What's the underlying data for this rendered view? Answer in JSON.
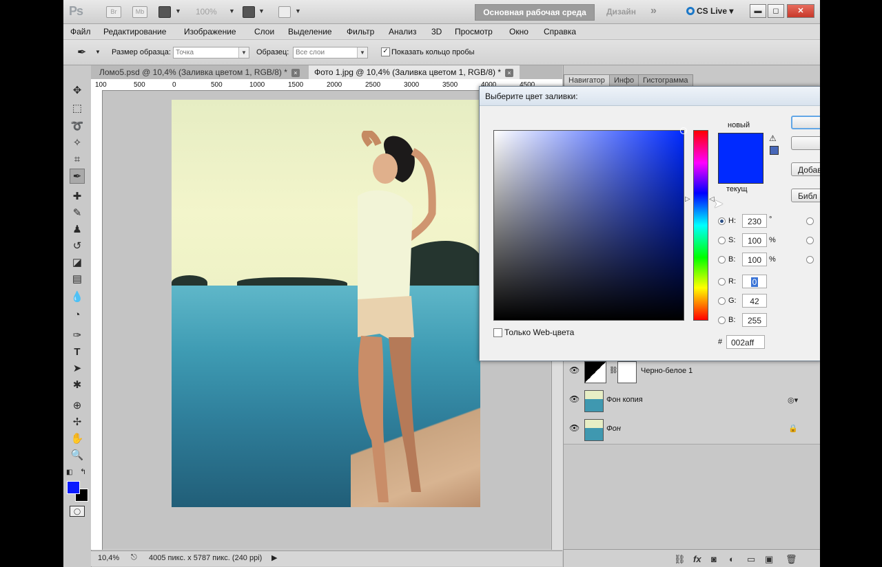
{
  "appbar": {
    "logo": "Ps",
    "bridge": "Br",
    "minibridge": "Mb",
    "zoom": "100%",
    "workspace_active": "Основная рабочая среда",
    "workspace_design": "Дизайн",
    "workspace_more": "»",
    "cslive": "CS Live"
  },
  "menu": [
    "Файл",
    "Редактирование",
    "Изображение",
    "Слои",
    "Выделение",
    "Фильтр",
    "Анализ",
    "3D",
    "Просмотр",
    "Окно",
    "Справка"
  ],
  "options": {
    "sample_size_label": "Размер образца:",
    "sample_size_value": "Точка",
    "sample_label": "Образец:",
    "sample_value": "Все слои",
    "show_ring_label": "Показать кольцо пробы",
    "show_ring_checked": true
  },
  "doc_tabs": [
    {
      "title": "Ломо5.psd @ 10,4% (Заливка цветом 1, RGB/8) *",
      "active": false
    },
    {
      "title": "Фото 1.jpg @ 10,4% (Заливка цветом 1, RGB/8) *",
      "active": true
    }
  ],
  "ruler_ticks": [
    "100",
    "500",
    "0",
    "500",
    "1000",
    "1500",
    "2000",
    "2500",
    "3000",
    "3500",
    "4000",
    "4500"
  ],
  "statusbar": {
    "zoom": "10,4%",
    "doc_info": "4005 пикс. x 5787 пикс. (240 ppi)"
  },
  "panel_tabs": [
    "Навигатор",
    "Инфо",
    "Гистограмма"
  ],
  "layers": [
    {
      "name": "Черно-белое 1"
    },
    {
      "name": "Фон копия"
    },
    {
      "name": "Фон"
    }
  ],
  "picker": {
    "title": "Выберите цвет заливки:",
    "new_label": "новый",
    "current_label": "текущ",
    "new_color": "#002aff",
    "current_color": "#002aff",
    "h_label": "H:",
    "h_value": "230",
    "h_unit": "°",
    "s_label": "S:",
    "s_value": "100",
    "s_unit": "%",
    "b_label": "B:",
    "b_value": "100",
    "b_unit": "%",
    "r_label": "R:",
    "r_value": "0",
    "g_label": "G:",
    "g_value": "42",
    "bl_label": "B:",
    "bl_value": "255",
    "hex_label": "#",
    "hex_value": "002aff",
    "web_only_label": "Только Web-цвета",
    "web_only_checked": false,
    "selected_channel": "H",
    "btn_add": "Добав",
    "btn_library": "Библ"
  },
  "foreground_color": "#0a1aff",
  "background_color": "#000000"
}
